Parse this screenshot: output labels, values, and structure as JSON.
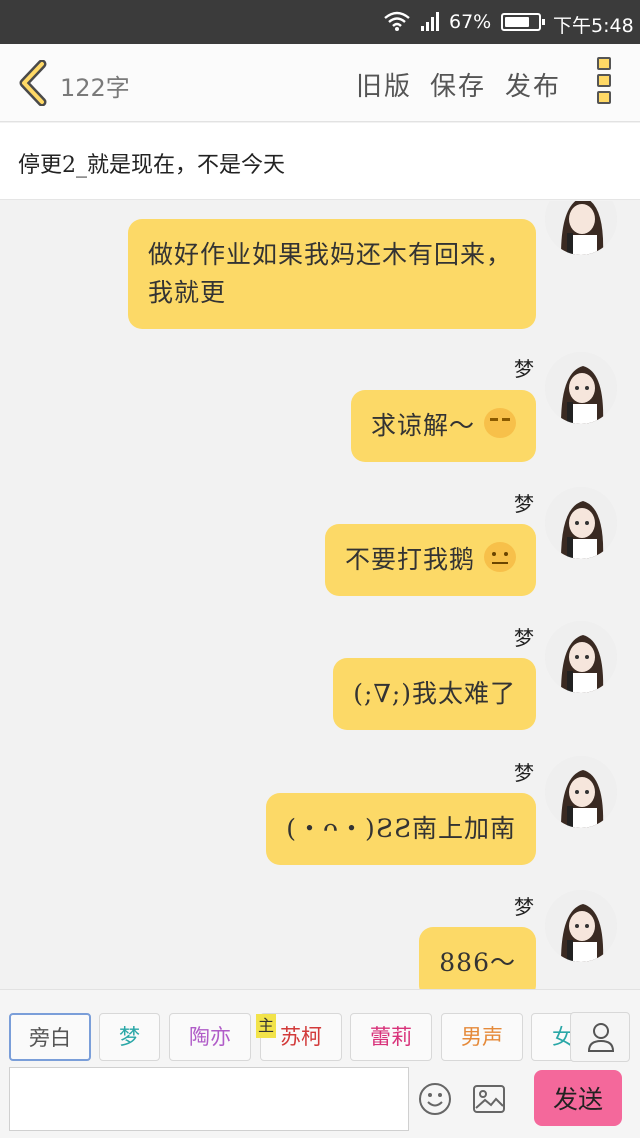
{
  "status_bar": {
    "battery_percent": "67%",
    "time": "下午5:48"
  },
  "header": {
    "word_count": "122字",
    "actions": {
      "old_version": "旧版",
      "save": "保存",
      "publish": "发布"
    }
  },
  "story": {
    "title": "停更2_就是现在，不是今天"
  },
  "messages": [
    {
      "speaker": "",
      "text": "做好作业如果我妈还木有回来，我就更",
      "emoji": ""
    },
    {
      "speaker": "梦",
      "text": "求谅解～",
      "emoji": "crying-face"
    },
    {
      "speaker": "梦",
      "text": "不要打我鹅",
      "emoji": "neutral-face"
    },
    {
      "speaker": "梦",
      "text": "(;∇;)我太难了",
      "emoji": ""
    },
    {
      "speaker": "梦",
      "text": "(・ᴖ・)ƧƧ南上加南",
      "emoji": ""
    },
    {
      "speaker": "梦",
      "text": "886～",
      "emoji": ""
    }
  ],
  "characters": [
    {
      "label": "旁白",
      "color": "#555555",
      "active": true
    },
    {
      "label": "梦",
      "color": "#2aa7a7",
      "active": false
    },
    {
      "label": "陶亦",
      "color": "#b05cc8",
      "active": false
    },
    {
      "label": "苏柯",
      "color": "#d23a3a",
      "active": false
    },
    {
      "label": "蕾莉",
      "color": "#d8327a",
      "active": false
    },
    {
      "label": "男声",
      "color": "#e58a3a",
      "active": false
    },
    {
      "label": "女",
      "color": "#2aa7a7",
      "active": false
    }
  ],
  "main_badge": "主",
  "composer": {
    "placeholder": "",
    "send_label": "发送"
  },
  "colors": {
    "bubble": "#fcd967",
    "send": "#f4689b",
    "status_bar": "#3b3b3b"
  }
}
